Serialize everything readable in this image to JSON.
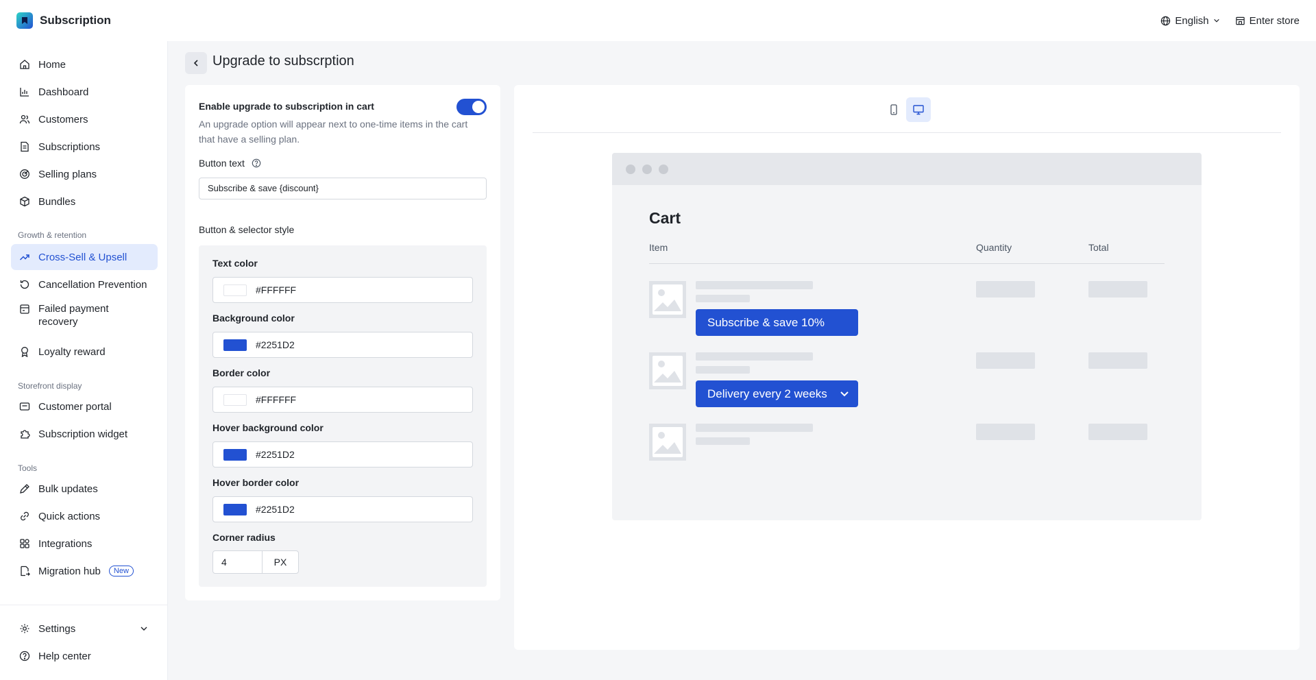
{
  "app": {
    "title": "Subscription"
  },
  "topbar": {
    "language": "English",
    "enter_store": "Enter store"
  },
  "sidebar": {
    "main": [
      {
        "label": "Home"
      },
      {
        "label": "Dashboard"
      },
      {
        "label": "Customers"
      },
      {
        "label": "Subscriptions"
      },
      {
        "label": "Selling plans"
      },
      {
        "label": "Bundles"
      }
    ],
    "growth_section": "Growth & retention",
    "growth": [
      {
        "label": "Cross-Sell & Upsell"
      },
      {
        "label": "Cancellation Prevention"
      },
      {
        "label": "Failed payment recovery"
      },
      {
        "label": "Loyalty reward"
      }
    ],
    "storefront_section": "Storefront display",
    "storefront": [
      {
        "label": "Customer portal"
      },
      {
        "label": "Subscription widget"
      }
    ],
    "tools_section": "Tools",
    "tools": [
      {
        "label": "Bulk updates"
      },
      {
        "label": "Quick actions"
      },
      {
        "label": "Integrations"
      },
      {
        "label": "Migration hub",
        "badge": "New"
      }
    ],
    "bottom": [
      {
        "label": "Settings"
      },
      {
        "label": "Help center"
      }
    ]
  },
  "page": {
    "title": "Upgrade to subscrption"
  },
  "settings": {
    "enable_label": "Enable upgrade to subscription in cart",
    "enable_value": true,
    "enable_desc": "An upgrade option will appear next to one-time items in the cart that have a selling plan.",
    "button_text_label": "Button text",
    "button_text_value": "Subscribe & save {discount}",
    "style_heading": "Button & selector style",
    "text_color_label": "Text color",
    "text_color": "#FFFFFF",
    "bg_color_label": "Background color",
    "bg_color": "#2251D2",
    "border_color_label": "Border color",
    "border_color": "#FFFFFF",
    "hover_bg_label": "Hover background color",
    "hover_bg": "#2251D2",
    "hover_border_label": "Hover border color",
    "hover_border": "#2251D2",
    "radius_label": "Corner radius",
    "radius_value": "4",
    "radius_unit": "PX"
  },
  "preview": {
    "cart_title": "Cart",
    "col_item": "Item",
    "col_quantity": "Quantity",
    "col_total": "Total",
    "subscribe_button": "Subscribe & save 10%",
    "delivery_select": "Delivery every 2 weeks"
  },
  "colors": {
    "accent": "#2251D2",
    "active_bg": "#E3EBFD"
  }
}
